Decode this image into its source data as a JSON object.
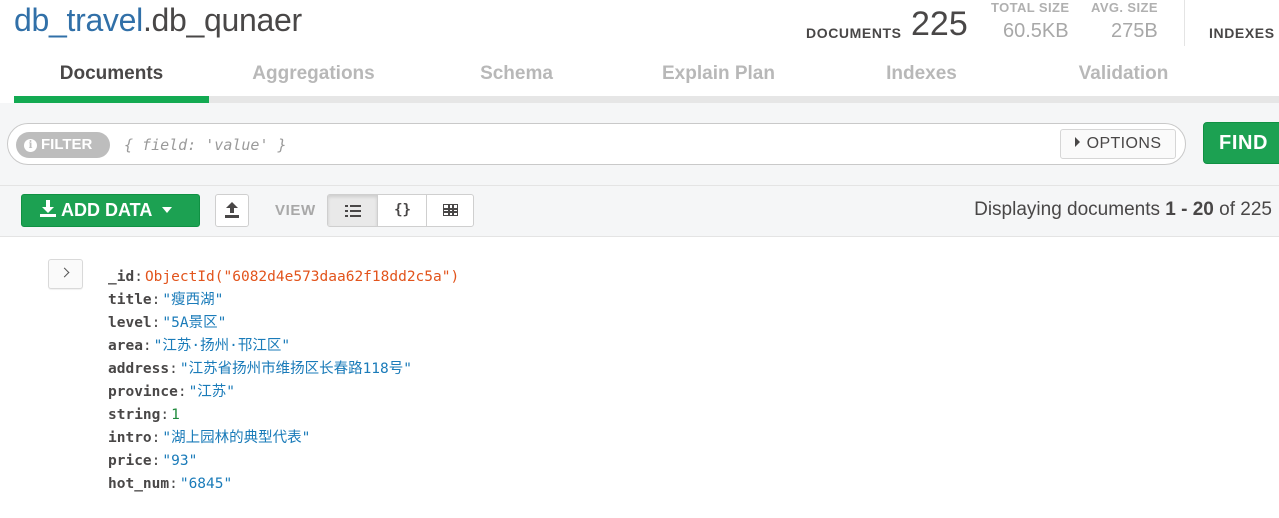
{
  "namespace": {
    "database": "db_travel",
    "separator": ".",
    "collection": "db_qunaer"
  },
  "stats": {
    "documents_label": "DOCUMENTS",
    "documents_value": "225",
    "total_size_label": "TOTAL SIZE",
    "total_size_value": "60.5KB",
    "avg_size_label": "AVG. SIZE",
    "avg_size_value": "275B",
    "indexes_label": "INDEXES"
  },
  "tabs": [
    {
      "label": "Documents",
      "active": true
    },
    {
      "label": "Aggregations",
      "active": false
    },
    {
      "label": "Schema",
      "active": false
    },
    {
      "label": "Explain Plan",
      "active": false
    },
    {
      "label": "Indexes",
      "active": false
    },
    {
      "label": "Validation",
      "active": false
    }
  ],
  "querybar": {
    "filter_label": "FILTER",
    "filter_info_glyph": "i",
    "filter_placeholder": "{ field: 'value' }",
    "options_label": "OPTIONS",
    "find_label": "FIND"
  },
  "toolbar": {
    "add_data_label": "ADD DATA",
    "view_label": "VIEW",
    "view_modes": [
      "list",
      "json",
      "table"
    ],
    "active_view": "list",
    "braces_glyph": "{}",
    "pager": {
      "prefix": "Displaying documents",
      "start": "1",
      "dash": "-",
      "end": "20",
      "of": "of",
      "total": "225"
    }
  },
  "document": {
    "fields": [
      {
        "key": "_id",
        "value": "ObjectId(\"6082d4e573daa62f18dd2c5a\")",
        "type": "objectid"
      },
      {
        "key": "title",
        "value": "\"瘦西湖\"",
        "type": "string"
      },
      {
        "key": "level",
        "value": "\"5A景区\"",
        "type": "string"
      },
      {
        "key": "area",
        "value": "\"江苏·扬州·邗江区\"",
        "type": "string"
      },
      {
        "key": "address",
        "value": "\"江苏省扬州市维扬区长春路118号\"",
        "type": "string"
      },
      {
        "key": "province",
        "value": "\"江苏\"",
        "type": "string"
      },
      {
        "key": "string",
        "value": "1",
        "type": "number"
      },
      {
        "key": "intro",
        "value": "\"湖上园林的典型代表\"",
        "type": "string"
      },
      {
        "key": "price",
        "value": "\"93\"",
        "type": "string"
      },
      {
        "key": "hot_num",
        "value": "\"6845\"",
        "type": "string"
      }
    ]
  },
  "colors": {
    "accent_green": "#13aa52",
    "button_green": "#1ca152",
    "db_blue": "#3170a8",
    "objectid_orange": "#e2541c",
    "string_blue": "#1a7bb9",
    "number_green": "#1f8a3c"
  }
}
